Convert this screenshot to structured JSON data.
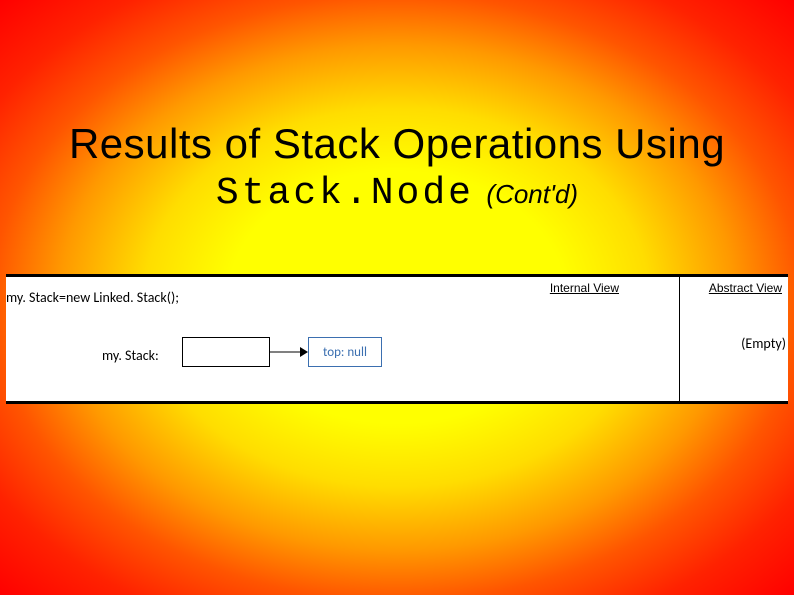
{
  "title": {
    "line1": "Results of Stack Operations Using",
    "line2": "Stack.Node",
    "contd": "(Cont'd)"
  },
  "diagram": {
    "internal_header": "Internal View",
    "abstract_header": "Abstract View",
    "code_line": "my. Stack=new Linked. Stack();",
    "var_label": "my. Stack:",
    "topnull": "top: null",
    "empty_label": "(Empty)"
  }
}
